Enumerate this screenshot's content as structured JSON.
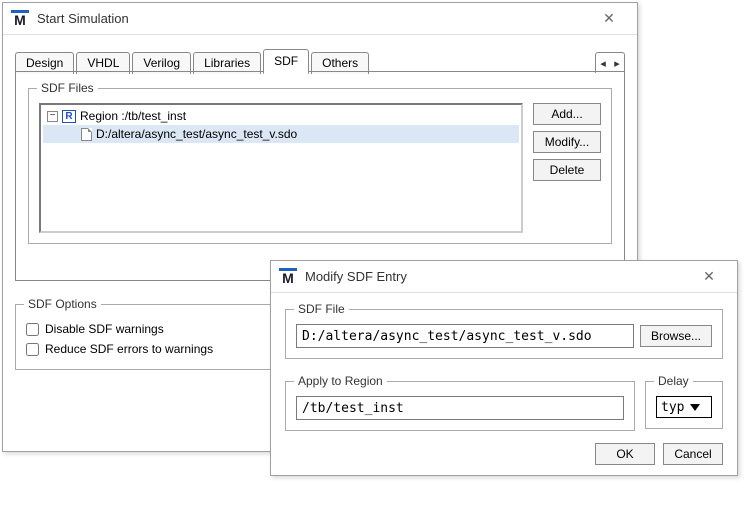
{
  "main_window": {
    "title": "Start Simulation",
    "tabs": [
      "Design",
      "VHDL",
      "Verilog",
      "Libraries",
      "SDF",
      "Others"
    ],
    "active_tab_index": 4,
    "sdf_files": {
      "legend": "SDF Files",
      "region_prefix": "Region : ",
      "region_path": "/tb/test_inst",
      "file_path": "D:/altera/async_test/async_test_v.sdo",
      "buttons": {
        "add": "Add...",
        "modify": "Modify...",
        "delete": "Delete"
      }
    },
    "sdf_options": {
      "legend": "SDF Options",
      "opt_disable": "Disable SDF warnings",
      "opt_reduce": "Reduce SDF errors to warnings"
    }
  },
  "dialog": {
    "title": "Modify SDF Entry",
    "sdf_file": {
      "legend": "SDF File",
      "value": "D:/altera/async_test/async_test_v.sdo",
      "browse": "Browse..."
    },
    "apply_region": {
      "legend": "Apply to Region",
      "value": "/tb/test_inst"
    },
    "delay": {
      "legend": "Delay",
      "value": "typ"
    },
    "ok": "OK",
    "cancel": "Cancel"
  }
}
